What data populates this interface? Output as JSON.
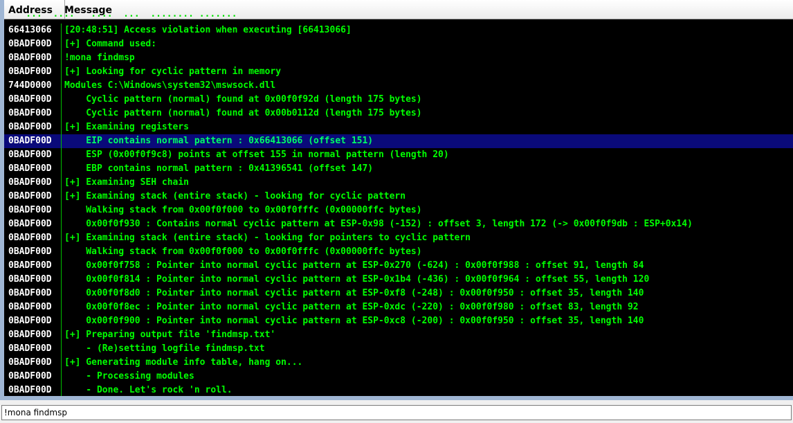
{
  "header": {
    "address_label": "Address",
    "message_label": "Message"
  },
  "partial_row": "    ...  ....   ....  ...  ........ .......",
  "log_rows": [
    {
      "address": "66413066",
      "message": "[20:48:51] Access violation when executing [66413066]"
    },
    {
      "address": "0BADF00D",
      "message": "[+] Command used:"
    },
    {
      "address": "0BADF00D",
      "message": "!mona findmsp"
    },
    {
      "address": "0BADF00D",
      "message": "[+] Looking for cyclic pattern in memory"
    },
    {
      "address": "744D0000",
      "message": "Modules C:\\Windows\\system32\\mswsock.dll"
    },
    {
      "address": "0BADF00D",
      "message": "    Cyclic pattern (normal) found at 0x00f0f92d (length 175 bytes)"
    },
    {
      "address": "0BADF00D",
      "message": "    Cyclic pattern (normal) found at 0x00b0112d (length 175 bytes)"
    },
    {
      "address": "0BADF00D",
      "message": "[+] Examining registers"
    },
    {
      "address": "0BADF00D",
      "message": "    EIP contains normal pattern : 0x66413066 (offset 151)",
      "selected": true
    },
    {
      "address": "0BADF00D",
      "message": "    ESP (0x00f0f9c8) points at offset 155 in normal pattern (length 20)"
    },
    {
      "address": "0BADF00D",
      "message": "    EBP contains normal pattern : 0x41396541 (offset 147)"
    },
    {
      "address": "0BADF00D",
      "message": "[+] Examining SEH chain"
    },
    {
      "address": "0BADF00D",
      "message": "[+] Examining stack (entire stack) - looking for cyclic pattern"
    },
    {
      "address": "0BADF00D",
      "message": "    Walking stack from 0x00f0f000 to 0x00f0fffc (0x00000ffc bytes)"
    },
    {
      "address": "0BADF00D",
      "message": "    0x00f0f930 : Contains normal cyclic pattern at ESP-0x98 (-152) : offset 3, length 172 (-> 0x00f0f9db : ESP+0x14)"
    },
    {
      "address": "0BADF00D",
      "message": "[+] Examining stack (entire stack) - looking for pointers to cyclic pattern"
    },
    {
      "address": "0BADF00D",
      "message": "    Walking stack from 0x00f0f000 to 0x00f0fffc (0x00000ffc bytes)"
    },
    {
      "address": "0BADF00D",
      "message": "    0x00f0f758 : Pointer into normal cyclic pattern at ESP-0x270 (-624) : 0x00f0f988 : offset 91, length 84"
    },
    {
      "address": "0BADF00D",
      "message": "    0x00f0f814 : Pointer into normal cyclic pattern at ESP-0x1b4 (-436) : 0x00f0f964 : offset 55, length 120"
    },
    {
      "address": "0BADF00D",
      "message": "    0x00f0f8d0 : Pointer into normal cyclic pattern at ESP-0xf8 (-248) : 0x00f0f950 : offset 35, length 140"
    },
    {
      "address": "0BADF00D",
      "message": "    0x00f0f8ec : Pointer into normal cyclic pattern at ESP-0xdc (-220) : 0x00f0f980 : offset 83, length 92"
    },
    {
      "address": "0BADF00D",
      "message": "    0x00f0f900 : Pointer into normal cyclic pattern at ESP-0xc8 (-200) : 0x00f0f950 : offset 35, length 140"
    },
    {
      "address": "0BADF00D",
      "message": "[+] Preparing output file 'findmsp.txt'"
    },
    {
      "address": "0BADF00D",
      "message": "    - (Re)setting logfile findmsp.txt"
    },
    {
      "address": "0BADF00D",
      "message": "[+] Generating module info table, hang on..."
    },
    {
      "address": "0BADF00D",
      "message": "    - Processing modules"
    },
    {
      "address": "0BADF00D",
      "message": "    - Done. Let's rock 'n roll."
    }
  ],
  "command_bar": {
    "value": "!mona findmsp"
  },
  "colors": {
    "text_green": "#00ff00",
    "address_white": "#ffffff",
    "selected_bg": "#0a0a7a",
    "background": "#000000"
  }
}
